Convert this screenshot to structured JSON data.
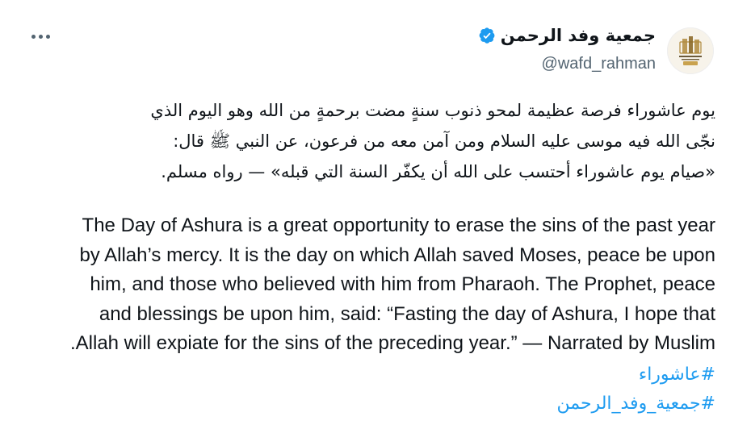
{
  "account": {
    "display_name": "جمعية وفد الرحمن",
    "handle": "@wafd_rahman",
    "avatar_icon": "wafd-rahman-logo",
    "verified_icon": "verified-badge-icon",
    "verified_color": "#1d9bf0"
  },
  "menu": {
    "more_icon": "more-options-icon"
  },
  "post": {
    "arabic_lines": [
      "يوم عاشوراء فرصة عظيمة لمحو ذنوب سنةٍ مضت برحمةٍ من الله وهو اليوم الذي",
      "نجّى الله فيه موسى عليه السلام ومن آمن معه من فرعون، عن النبي ﷺ قال:",
      "«صيام يوم عاشوراء أحتسب على الله أن يكفّر السنة التي قبله» — رواه مسلم."
    ],
    "english_lines": [
      "The Day of Ashura is a great opportunity to erase the sins of the past year",
      "by Allah’s mercy. It is the day on which Allah saved Moses, peace be upon",
      "him, and those who believed with him from Pharaoh. The Prophet, peace",
      "and blessings be upon him, said: “Fasting the day of Ashura, I hope that",
      "Allah will expiate for the sins of the preceding year.” — Narrated by Muslim."
    ],
    "hashtags": [
      "#عاشوراء",
      "#جمعية_وفد_الرحمن"
    ]
  },
  "colors": {
    "text": "#0f1419",
    "secondary": "#536471",
    "link": "#1d9bf0"
  }
}
